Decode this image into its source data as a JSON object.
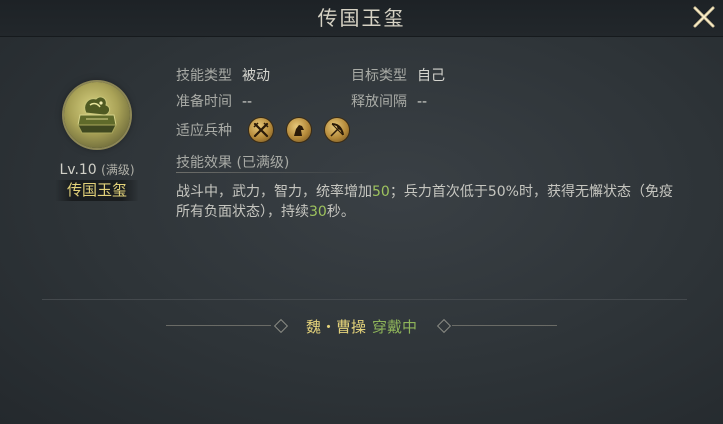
{
  "header": {
    "title": "传国玉玺",
    "close_icon": "close-icon"
  },
  "skill": {
    "icon": "jade-seal-icon",
    "level": "Lv.10",
    "level_note": "(满级)",
    "name": "传国玉玺"
  },
  "attributes": {
    "skill_type_label": "技能类型",
    "skill_type_value": "被动",
    "target_type_label": "目标类型",
    "target_type_value": "自己",
    "prep_time_label": "准备时间",
    "prep_time_value": "--",
    "cast_interval_label": "释放间隔",
    "cast_interval_value": "--",
    "troop_label": "适应兵种",
    "troops": [
      "infantry-swords-icon",
      "cavalry-horse-icon",
      "archer-bow-icon"
    ]
  },
  "effect": {
    "title": "技能效果 (已满级)",
    "text_part1": "战斗中，武力，智力，统率增加",
    "value1": "50",
    "text_part2": "；兵力首次低于50%时，获得无懈状态（免疫所有负面状态），持续",
    "value2": "30",
    "text_part3": "秒。"
  },
  "equipped": {
    "hero": "魏・曹操",
    "state": "穿戴中"
  },
  "colors": {
    "gold": "#e3d27a",
    "green": "#9ec35e",
    "background": "#2e3438"
  }
}
